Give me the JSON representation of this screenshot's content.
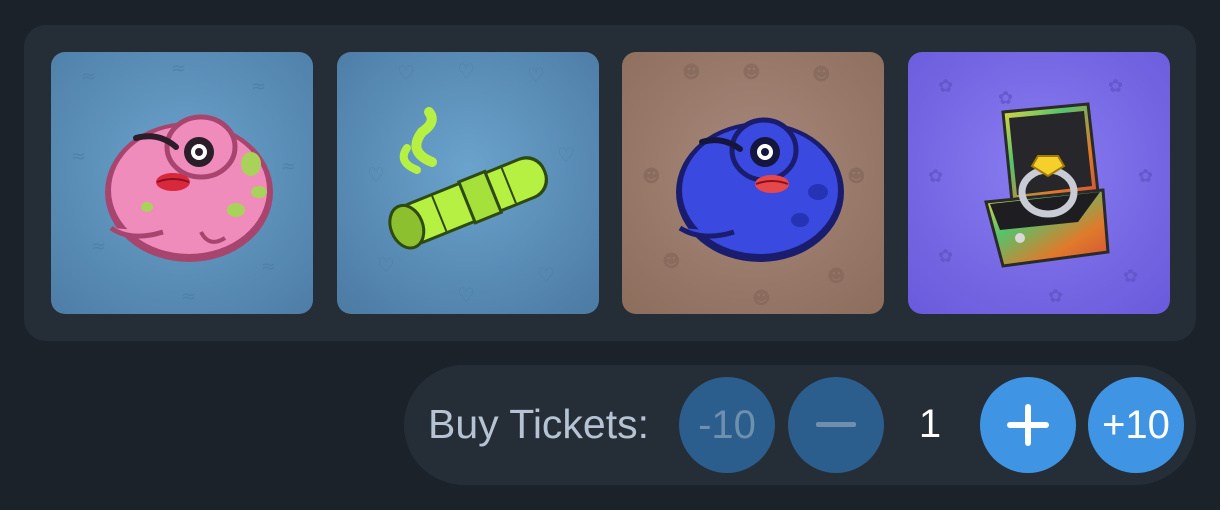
{
  "gifts": [
    {
      "name": "Pink Frog",
      "icon": "pink-frog-icon",
      "background": "#5b8fb8"
    },
    {
      "name": "Green Cigar",
      "icon": "cigar-icon",
      "background": "#5a8ab1"
    },
    {
      "name": "Blue Frog",
      "icon": "blue-frog-icon",
      "background": "#9b7a66"
    },
    {
      "name": "Ring Box",
      "icon": "ring-box-icon",
      "background": "#7568e0"
    }
  ],
  "tickets": {
    "label": "Buy Tickets:",
    "minus_ten_label": "-10",
    "minus_label": "—",
    "quantity": "1",
    "plus_label": "+",
    "plus_ten_label": "+10"
  },
  "colors": {
    "page_background": "#1c2229",
    "panel_background": "#252d37",
    "button_dim": "#2b5d8d",
    "button_bright": "#3f95e4"
  }
}
